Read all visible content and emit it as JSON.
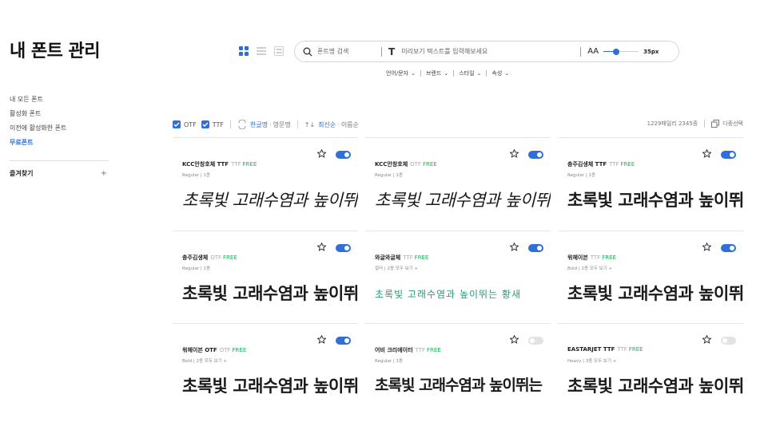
{
  "sidebar": {
    "title": "내 폰트 관리",
    "items": [
      {
        "label": "내 모든 폰트",
        "active": false
      },
      {
        "label": "활성화 폰트",
        "active": false
      },
      {
        "label": "이전에 활성화한 폰트",
        "active": false
      },
      {
        "label": "무료폰트",
        "active": true
      }
    ],
    "favorites_label": "즐겨찾기",
    "add_symbol": "+"
  },
  "toolbar": {
    "search_placeholder": "폰트명 검색",
    "preview_placeholder": "미리보기 텍스트를 입력해보세요",
    "aa_label": "AA",
    "size_value": "35px",
    "size_fraction": 0.35,
    "filters": [
      "언어/문자",
      "브랜드",
      "스타일",
      "속성"
    ]
  },
  "options": {
    "otf": "OTF",
    "ttf": "TTF",
    "sort_name_active": "한글명",
    "sort_name_other": "영문명",
    "sort_date_active": "최신순",
    "sort_date_other": "이름순",
    "count": "1229패밀리 2345종",
    "multi_select": "다중선택"
  },
  "cards": [
    {
      "name": "KCC안창호체 TTF",
      "tag": "TTF",
      "free": "FREE",
      "meta": "Regular | 1종",
      "preview": "초록빛 고래수염과 높이뛰",
      "style": "hand",
      "on": true
    },
    {
      "name": "KCC안창호체",
      "tag": "OTF",
      "free": "FREE",
      "meta": "Regular | 1종",
      "preview": "초록빛 고래수염과 높이뛰",
      "style": "hand",
      "on": true
    },
    {
      "name": "충주김생체 TTF",
      "tag": "TTF",
      "free": "FREE",
      "meta": "Regular | 1종",
      "preview": "초록빛 고래수염과 높이뛰",
      "style": "bold",
      "on": true
    },
    {
      "name": "충주김생체",
      "tag": "OTF",
      "free": "FREE",
      "meta": "Regular | 1종",
      "preview": "초록빛 고래수염과 높이뛰",
      "style": "bold",
      "on": true
    },
    {
      "name": "와글와글체",
      "tag": "TTF",
      "free": "FREE",
      "meta": "컬러 | 2종 모두 보기 +",
      "preview": "초록빛 고래수염과 높이뛰는 황새",
      "style": "deco",
      "on": true
    },
    {
      "name": "워헤이븐",
      "tag": "TTF",
      "free": "FREE",
      "meta": "Bold | 2종 모두 보기 +",
      "preview": "초록빛 고래수염과 높이뛰",
      "style": "bold",
      "on": true
    },
    {
      "name": "워헤이븐 OTF",
      "tag": "OTF",
      "free": "FREE",
      "meta": "Bold | 2종 모두 보기 +",
      "preview": "초록빛 고래수염과 높이뛰",
      "style": "bold",
      "on": true
    },
    {
      "name": "어비 크리에이터",
      "tag": "TTF",
      "free": "FREE",
      "meta": "Regular | 1종",
      "preview": "초록빛 고래수염과 높이뛰는",
      "style": "marker",
      "on": false
    },
    {
      "name": "EASTARJET TTF",
      "tag": "TTF",
      "free": "FREE",
      "meta": "Heavy | 3종 모두 보기 +",
      "preview": "초록빛 고래수염과 높이뛰",
      "style": "bold",
      "on": false
    }
  ],
  "colors": {
    "accent": "#2f6fd6",
    "free": "#1fae5b"
  }
}
